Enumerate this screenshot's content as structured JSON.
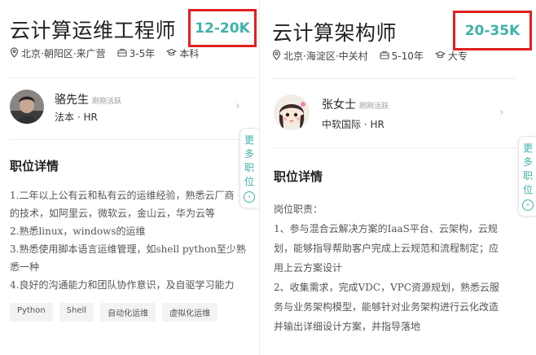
{
  "left": {
    "title": "云计算运维工程师",
    "salary": "12-20K",
    "location": "北京·朝阳区·来广营",
    "experience": "3-5年",
    "education": "本科",
    "hr": {
      "name": "骆先生",
      "status": "刚刚活跃",
      "company": "法本 · HR"
    },
    "section_title": "职位详情",
    "desc_lines": [
      "1.二年以上公有云和私有云的运维经验，熟悉云厂商",
      "的技术，如阿里云，微软云，金山云，华为云等",
      "2.熟悉linux，windows的运维",
      "3.熟悉使用脚本语言运维管理，如shell python至少熟",
      "悉一种",
      "4.良好的沟通能力和团队协作意识，及自驱学习能力"
    ],
    "tags": [
      "Python",
      "Shell",
      "自动化运维",
      "虚拟化运维"
    ],
    "side_tab": [
      "更",
      "多",
      "职",
      "位"
    ]
  },
  "right": {
    "title": "云计算架构师",
    "salary": "20-35K",
    "location": "北京·海淀区·中关村",
    "experience": "5-10年",
    "education": "大专",
    "hr": {
      "name": "张女士",
      "status": "刚刚活跃",
      "company": "中软国际 · HR"
    },
    "section_title": "职位详情",
    "desc_lines": [
      "岗位职责：",
      "1、参与混合云解决方案的IaaS平台、云架构，云规",
      "划，能够指导帮助客户完成上云规范和流程制定；应",
      "用上云方案设计",
      "2、收集需求，完成VDC，VPC资源规划，熟悉云服",
      "务与业务架构模型，能够针对业务架构进行云化改造",
      "并输出详细设计方案，并指导落地"
    ],
    "side_tab": [
      "更",
      "多",
      "职",
      "位"
    ]
  },
  "colors": {
    "accent": "#3fb2a9",
    "highlight_box": "#e02020"
  },
  "icons": {
    "location": "location-pin-icon",
    "experience": "briefcase-icon",
    "education": "graduation-cap-icon",
    "chevron": "chevron-right-icon",
    "more": "circle-chevron-left-icon"
  }
}
